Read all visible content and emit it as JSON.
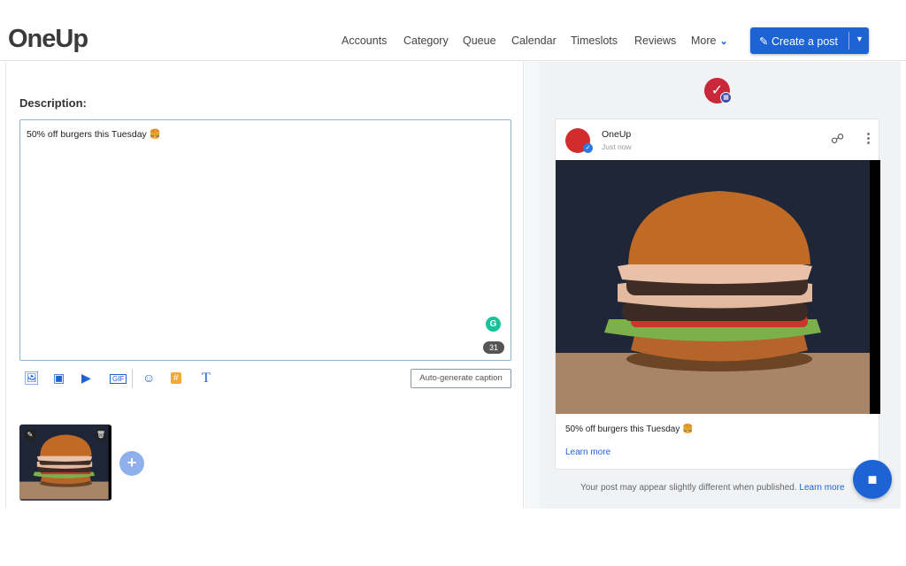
{
  "header": {
    "logo": "OneUp",
    "nav": [
      "Accounts",
      "Category",
      "Queue",
      "Calendar",
      "Timeslots",
      "Reviews",
      "More"
    ],
    "create_label": "Create a post"
  },
  "editor": {
    "description_label": "Description:",
    "text": "50% off burgers this Tuesday 🍔",
    "char_count": "31",
    "auto_caption": "Auto-generate caption",
    "tools": [
      "gallery-icon",
      "image-icon",
      "video-icon",
      "gif-icon",
      "emoji-icon",
      "hashtag-icon",
      "text-format-icon"
    ]
  },
  "preview": {
    "account_name": "OneUp",
    "time": "Just now",
    "caption": "50% off burgers this Tuesday 🍔",
    "learn_more": "Learn more",
    "note": "Your post may appear slightly different when published.",
    "note_link": "Learn more"
  },
  "colors": {
    "accent": "#1d63d6",
    "grammarly": "#15c39a"
  }
}
